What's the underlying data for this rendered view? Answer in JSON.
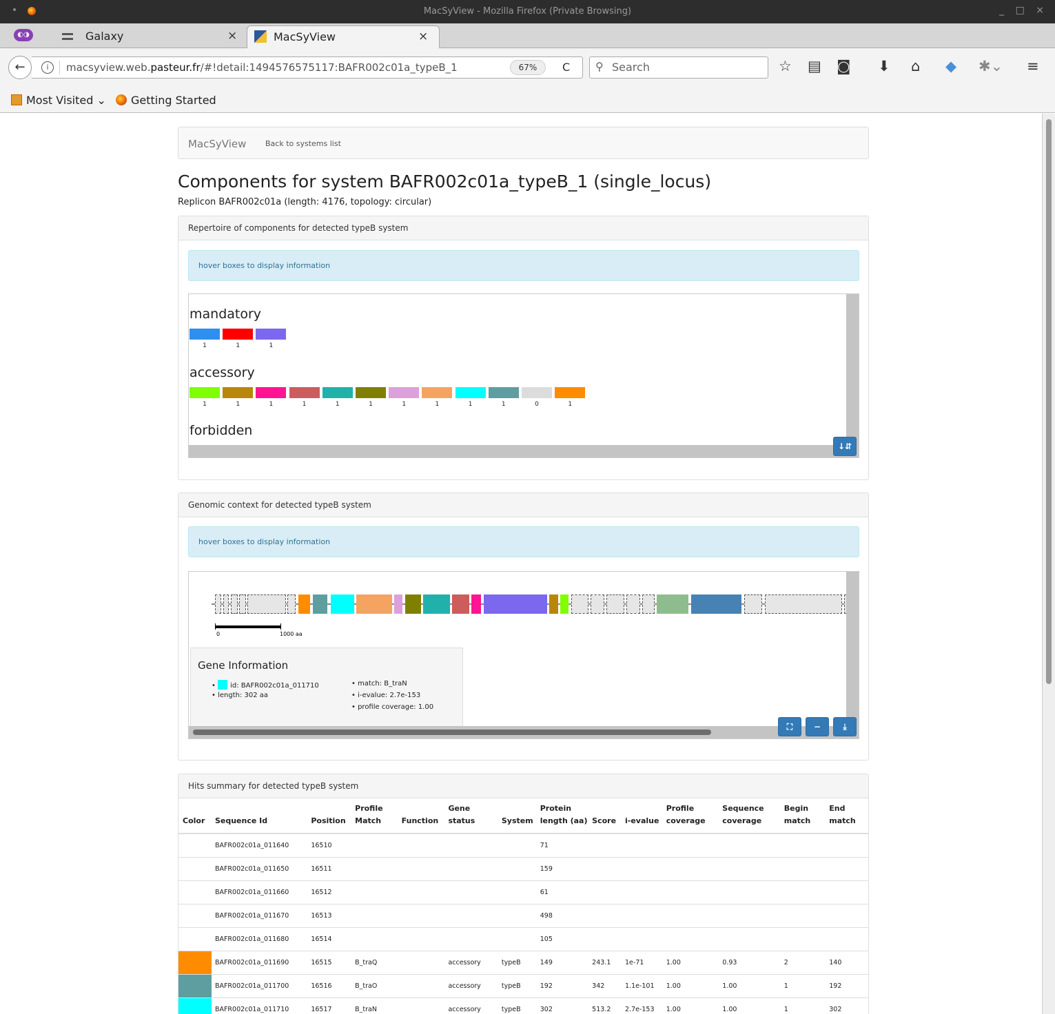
{
  "window": {
    "title": "MacSyView - Mozilla Firefox (Private Browsing)",
    "controls": "_ □ ×"
  },
  "tabs": [
    {
      "label": "Galaxy",
      "close": "×"
    },
    {
      "label": "MacSyView",
      "close": "×"
    }
  ],
  "new_tab": "+",
  "navbar": {
    "back": "←",
    "url_prefix": "macsyview.web.",
    "url_domain": "pasteur.fr",
    "url_suffix": "/#!detail:1494576575117:BAFR002c01a_typeB_1",
    "zoom": "67%",
    "reload": "C",
    "search_placeholder": "Search"
  },
  "bookmarks": [
    {
      "label": "Most Visited"
    },
    {
      "label": "Getting Started"
    }
  ],
  "page": {
    "brand": "MacSyView",
    "back_link": "Back to systems list",
    "title": "Components for system BAFR002c01a_typeB_1 (single_locus)",
    "subtitle": "Replicon BAFR002c01a (length: 4176, topology: circular)"
  },
  "repertoire": {
    "heading": "Repertoire of components for detected typeB system",
    "hint": "hover boxes to display information",
    "categories": [
      {
        "name": "mandatory",
        "items": [
          {
            "color": "#2d8ff0",
            "count": "1"
          },
          {
            "color": "#ff0000",
            "count": "1"
          },
          {
            "color": "#7b68ee",
            "count": "1"
          }
        ]
      },
      {
        "name": "accessory",
        "items": [
          {
            "color": "#7fff00",
            "count": "1"
          },
          {
            "color": "#b8860b",
            "count": "1"
          },
          {
            "color": "#ff1493",
            "count": "1"
          },
          {
            "color": "#cd5c5c",
            "count": "1"
          },
          {
            "color": "#20b2aa",
            "count": "1"
          },
          {
            "color": "#808000",
            "count": "1"
          },
          {
            "color": "#dda0dd",
            "count": "1"
          },
          {
            "color": "#f4a460",
            "count": "1"
          },
          {
            "color": "#00ffff",
            "count": "1"
          },
          {
            "color": "#5f9ea0",
            "count": "1"
          },
          {
            "color": "#dcdcdc",
            "count": "0"
          },
          {
            "color": "#ff8c00",
            "count": "1"
          }
        ]
      },
      {
        "name": "forbidden",
        "items": []
      }
    ]
  },
  "context": {
    "heading": "Genomic context for detected typeB system",
    "hint": "hover boxes to display information",
    "scale_start": "0",
    "scale_end": "1000 aa",
    "gene_info": {
      "title": "Gene Information",
      "color": "#00ffff",
      "id": "id: BAFR002c01a_011710",
      "length": "length: 302 aa",
      "match": "match: B_traN",
      "ievalue": "i-evalue: 2.7e-153",
      "coverage": "profile coverage: 1.00"
    }
  },
  "hits": {
    "heading": "Hits summary for detected typeB system",
    "columns": [
      "Color",
      "Sequence Id",
      "Position",
      "Profile Match",
      "Function",
      "Gene status",
      "System",
      "Protein length (aa)",
      "Score",
      "i-evalue",
      "Profile coverage",
      "Sequence coverage",
      "Begin match",
      "End match"
    ],
    "rows": [
      {
        "color": "",
        "seq": "BAFR002c01a_011640",
        "pos": "16510",
        "match": "",
        "func": "",
        "status": "",
        "system": "",
        "len": "71",
        "score": "",
        "ievalue": "",
        "pcov": "",
        "scov": "",
        "begin": "",
        "end": ""
      },
      {
        "color": "",
        "seq": "BAFR002c01a_011650",
        "pos": "16511",
        "match": "",
        "func": "",
        "status": "",
        "system": "",
        "len": "159",
        "score": "",
        "ievalue": "",
        "pcov": "",
        "scov": "",
        "begin": "",
        "end": ""
      },
      {
        "color": "",
        "seq": "BAFR002c01a_011660",
        "pos": "16512",
        "match": "",
        "func": "",
        "status": "",
        "system": "",
        "len": "61",
        "score": "",
        "ievalue": "",
        "pcov": "",
        "scov": "",
        "begin": "",
        "end": ""
      },
      {
        "color": "",
        "seq": "BAFR002c01a_011670",
        "pos": "16513",
        "match": "",
        "func": "",
        "status": "",
        "system": "",
        "len": "498",
        "score": "",
        "ievalue": "",
        "pcov": "",
        "scov": "",
        "begin": "",
        "end": ""
      },
      {
        "color": "",
        "seq": "BAFR002c01a_011680",
        "pos": "16514",
        "match": "",
        "func": "",
        "status": "",
        "system": "",
        "len": "105",
        "score": "",
        "ievalue": "",
        "pcov": "",
        "scov": "",
        "begin": "",
        "end": ""
      },
      {
        "color": "#ff8c00",
        "seq": "BAFR002c01a_011690",
        "pos": "16515",
        "match": "B_traQ",
        "func": "",
        "status": "accessory",
        "system": "typeB",
        "len": "149",
        "score": "243.1",
        "ievalue": "1e-71",
        "pcov": "1.00",
        "scov": "0.93",
        "begin": "2",
        "end": "140"
      },
      {
        "color": "#5f9ea0",
        "seq": "BAFR002c01a_011700",
        "pos": "16516",
        "match": "B_traO",
        "func": "",
        "status": "accessory",
        "system": "typeB",
        "len": "192",
        "score": "342",
        "ievalue": "1.1e-101",
        "pcov": "1.00",
        "scov": "1.00",
        "begin": "1",
        "end": "192"
      },
      {
        "color": "#00ffff",
        "seq": "BAFR002c01a_011710",
        "pos": "16517",
        "match": "B_traN",
        "func": "",
        "status": "accessory",
        "system": "typeB",
        "len": "302",
        "score": "513.2",
        "ievalue": "2.7e-153",
        "pcov": "1.00",
        "scov": "1.00",
        "begin": "1",
        "end": "302"
      }
    ]
  }
}
